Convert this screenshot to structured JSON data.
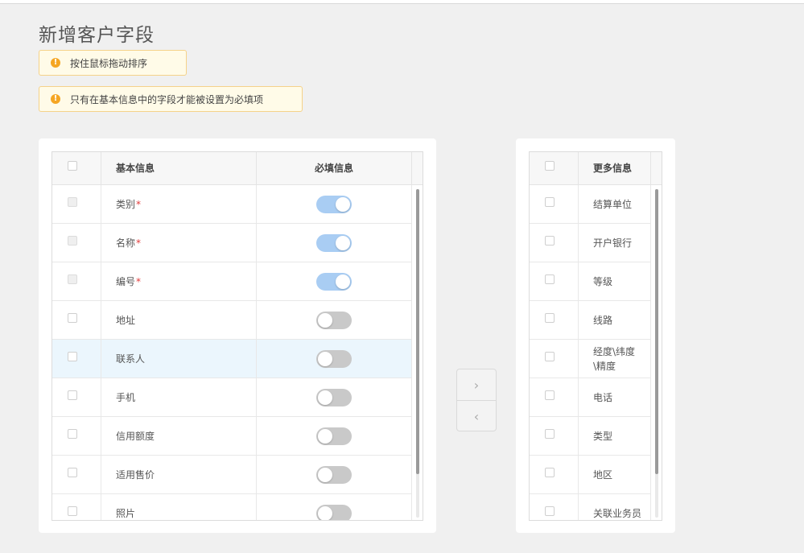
{
  "page": {
    "title": "新增客户字段"
  },
  "notices": [
    {
      "text": "按住鼠标拖动排序"
    },
    {
      "text": "只有在基本信息中的字段才能被设置为必填项"
    }
  ],
  "left_table": {
    "headers": {
      "name": "基本信息",
      "required": "必填信息"
    },
    "rows": [
      {
        "label": "类别",
        "required_mark": "*",
        "required": true,
        "locked": true,
        "highlighted": false
      },
      {
        "label": "名称",
        "required_mark": "*",
        "required": true,
        "locked": true,
        "highlighted": false
      },
      {
        "label": "编号",
        "required_mark": "*",
        "required": true,
        "locked": true,
        "highlighted": false
      },
      {
        "label": "地址",
        "required_mark": "",
        "required": false,
        "locked": false,
        "highlighted": false
      },
      {
        "label": "联系人",
        "required_mark": "",
        "required": false,
        "locked": false,
        "highlighted": true
      },
      {
        "label": "手机",
        "required_mark": "",
        "required": false,
        "locked": false,
        "highlighted": false
      },
      {
        "label": "信用额度",
        "required_mark": "",
        "required": false,
        "locked": false,
        "highlighted": false
      },
      {
        "label": "适用售价",
        "required_mark": "",
        "required": false,
        "locked": false,
        "highlighted": false
      },
      {
        "label": "照片",
        "required_mark": "",
        "required": false,
        "locked": false,
        "highlighted": false
      }
    ]
  },
  "right_table": {
    "headers": {
      "name": "更多信息"
    },
    "rows": [
      {
        "label": "结算单位"
      },
      {
        "label": "开户银行"
      },
      {
        "label": "等级"
      },
      {
        "label": "线路"
      },
      {
        "label": "经度\\纬度\\精度"
      },
      {
        "label": "电话"
      },
      {
        "label": "类型"
      },
      {
        "label": "地区"
      },
      {
        "label": "关联业务员"
      }
    ]
  },
  "transfer": {
    "right_arrow": "›",
    "left_arrow": "‹"
  },
  "icons": {
    "notice": "warning-circle-icon",
    "to_right": "chevron-right-icon",
    "to_left": "chevron-left-icon"
  },
  "colors": {
    "switch_on": "#a9cdf3",
    "switch_off": "#c9c9c9",
    "notice_bg": "#fffbe8",
    "warn": "#f5a623",
    "row_highlight": "#ebf6fd",
    "required_star": "#e23b3b"
  }
}
